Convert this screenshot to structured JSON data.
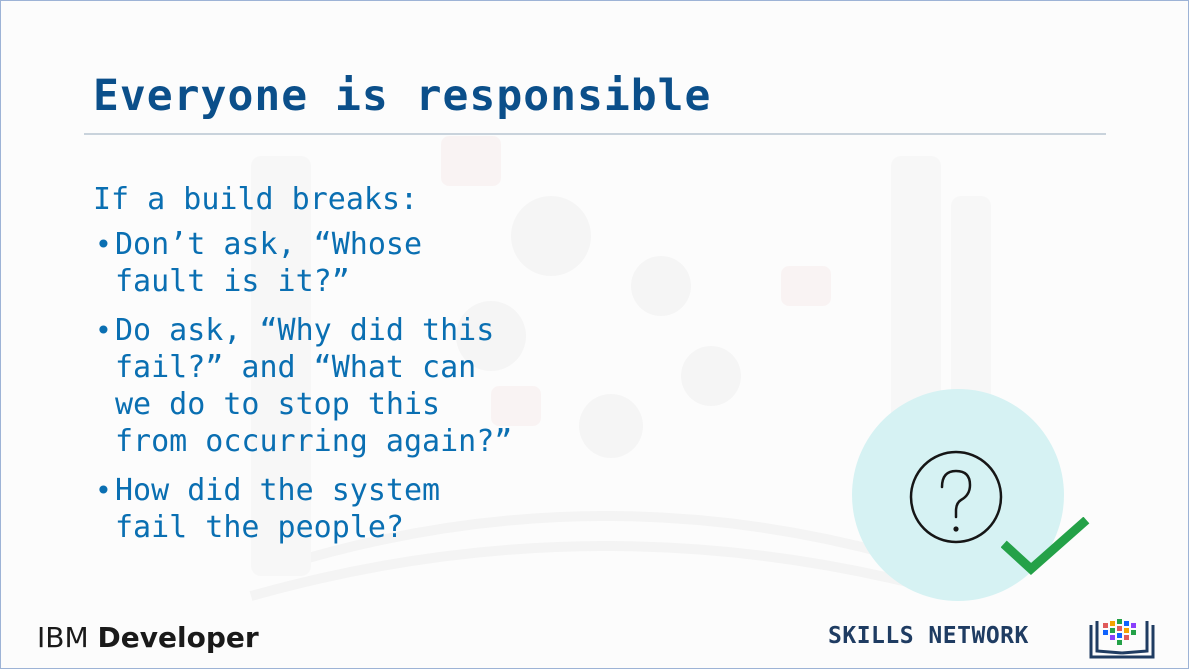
{
  "slide": {
    "title": "Everyone is responsible",
    "lead": "If a build breaks:",
    "bullets": [
      {
        "lines": [
          "Don’t ask, “Whose",
          "fault is it?”"
        ]
      },
      {
        "lines": [
          "Do ask, “Why did this",
          "fail?” and “What can",
          "we do to stop this",
          "from occurring again?”"
        ]
      },
      {
        "lines": [
          "How did the system",
          "fail the people?"
        ]
      }
    ],
    "bullet_glyph": "•"
  },
  "footer": {
    "brand_light": "IBM",
    "brand_bold": "Developer",
    "skills_network": "SKILLS NETWORK"
  },
  "icons": {
    "illustration": "question-mark-circle-icon",
    "check": "checkmark-icon",
    "logo": "skills-network-book-icon"
  },
  "colors": {
    "title": "#0b4f8a",
    "body_text": "#0a6fb2",
    "circle": "#d6f2f3",
    "check": "#24a148",
    "rule": "#c9d3dc"
  }
}
